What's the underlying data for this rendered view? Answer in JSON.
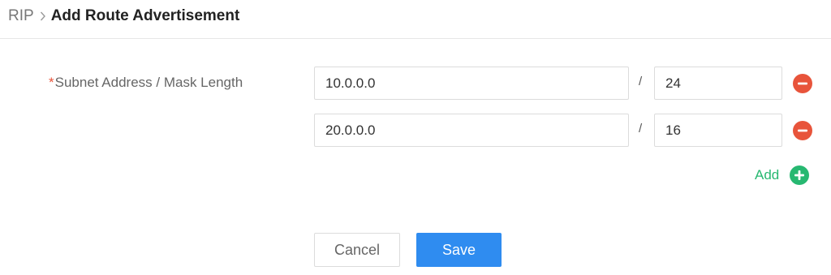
{
  "breadcrumb": {
    "root": "RIP",
    "current": "Add Route Advertisement"
  },
  "form": {
    "required_mark": "*",
    "label": "Subnet Address / Mask Length",
    "separator": "/",
    "rows": [
      {
        "address": "10.0.0.0",
        "mask": "24"
      },
      {
        "address": "20.0.0.0",
        "mask": "16"
      }
    ],
    "add_label": "Add"
  },
  "actions": {
    "cancel_label": "Cancel",
    "save_label": "Save"
  },
  "colors": {
    "remove": "#e8543b",
    "add": "#27b871",
    "primary": "#2f8cf0"
  },
  "icons": {
    "breadcrumb_separator": "chevron-right-icon",
    "remove": "minus-circle-icon",
    "add": "plus-circle-icon"
  }
}
